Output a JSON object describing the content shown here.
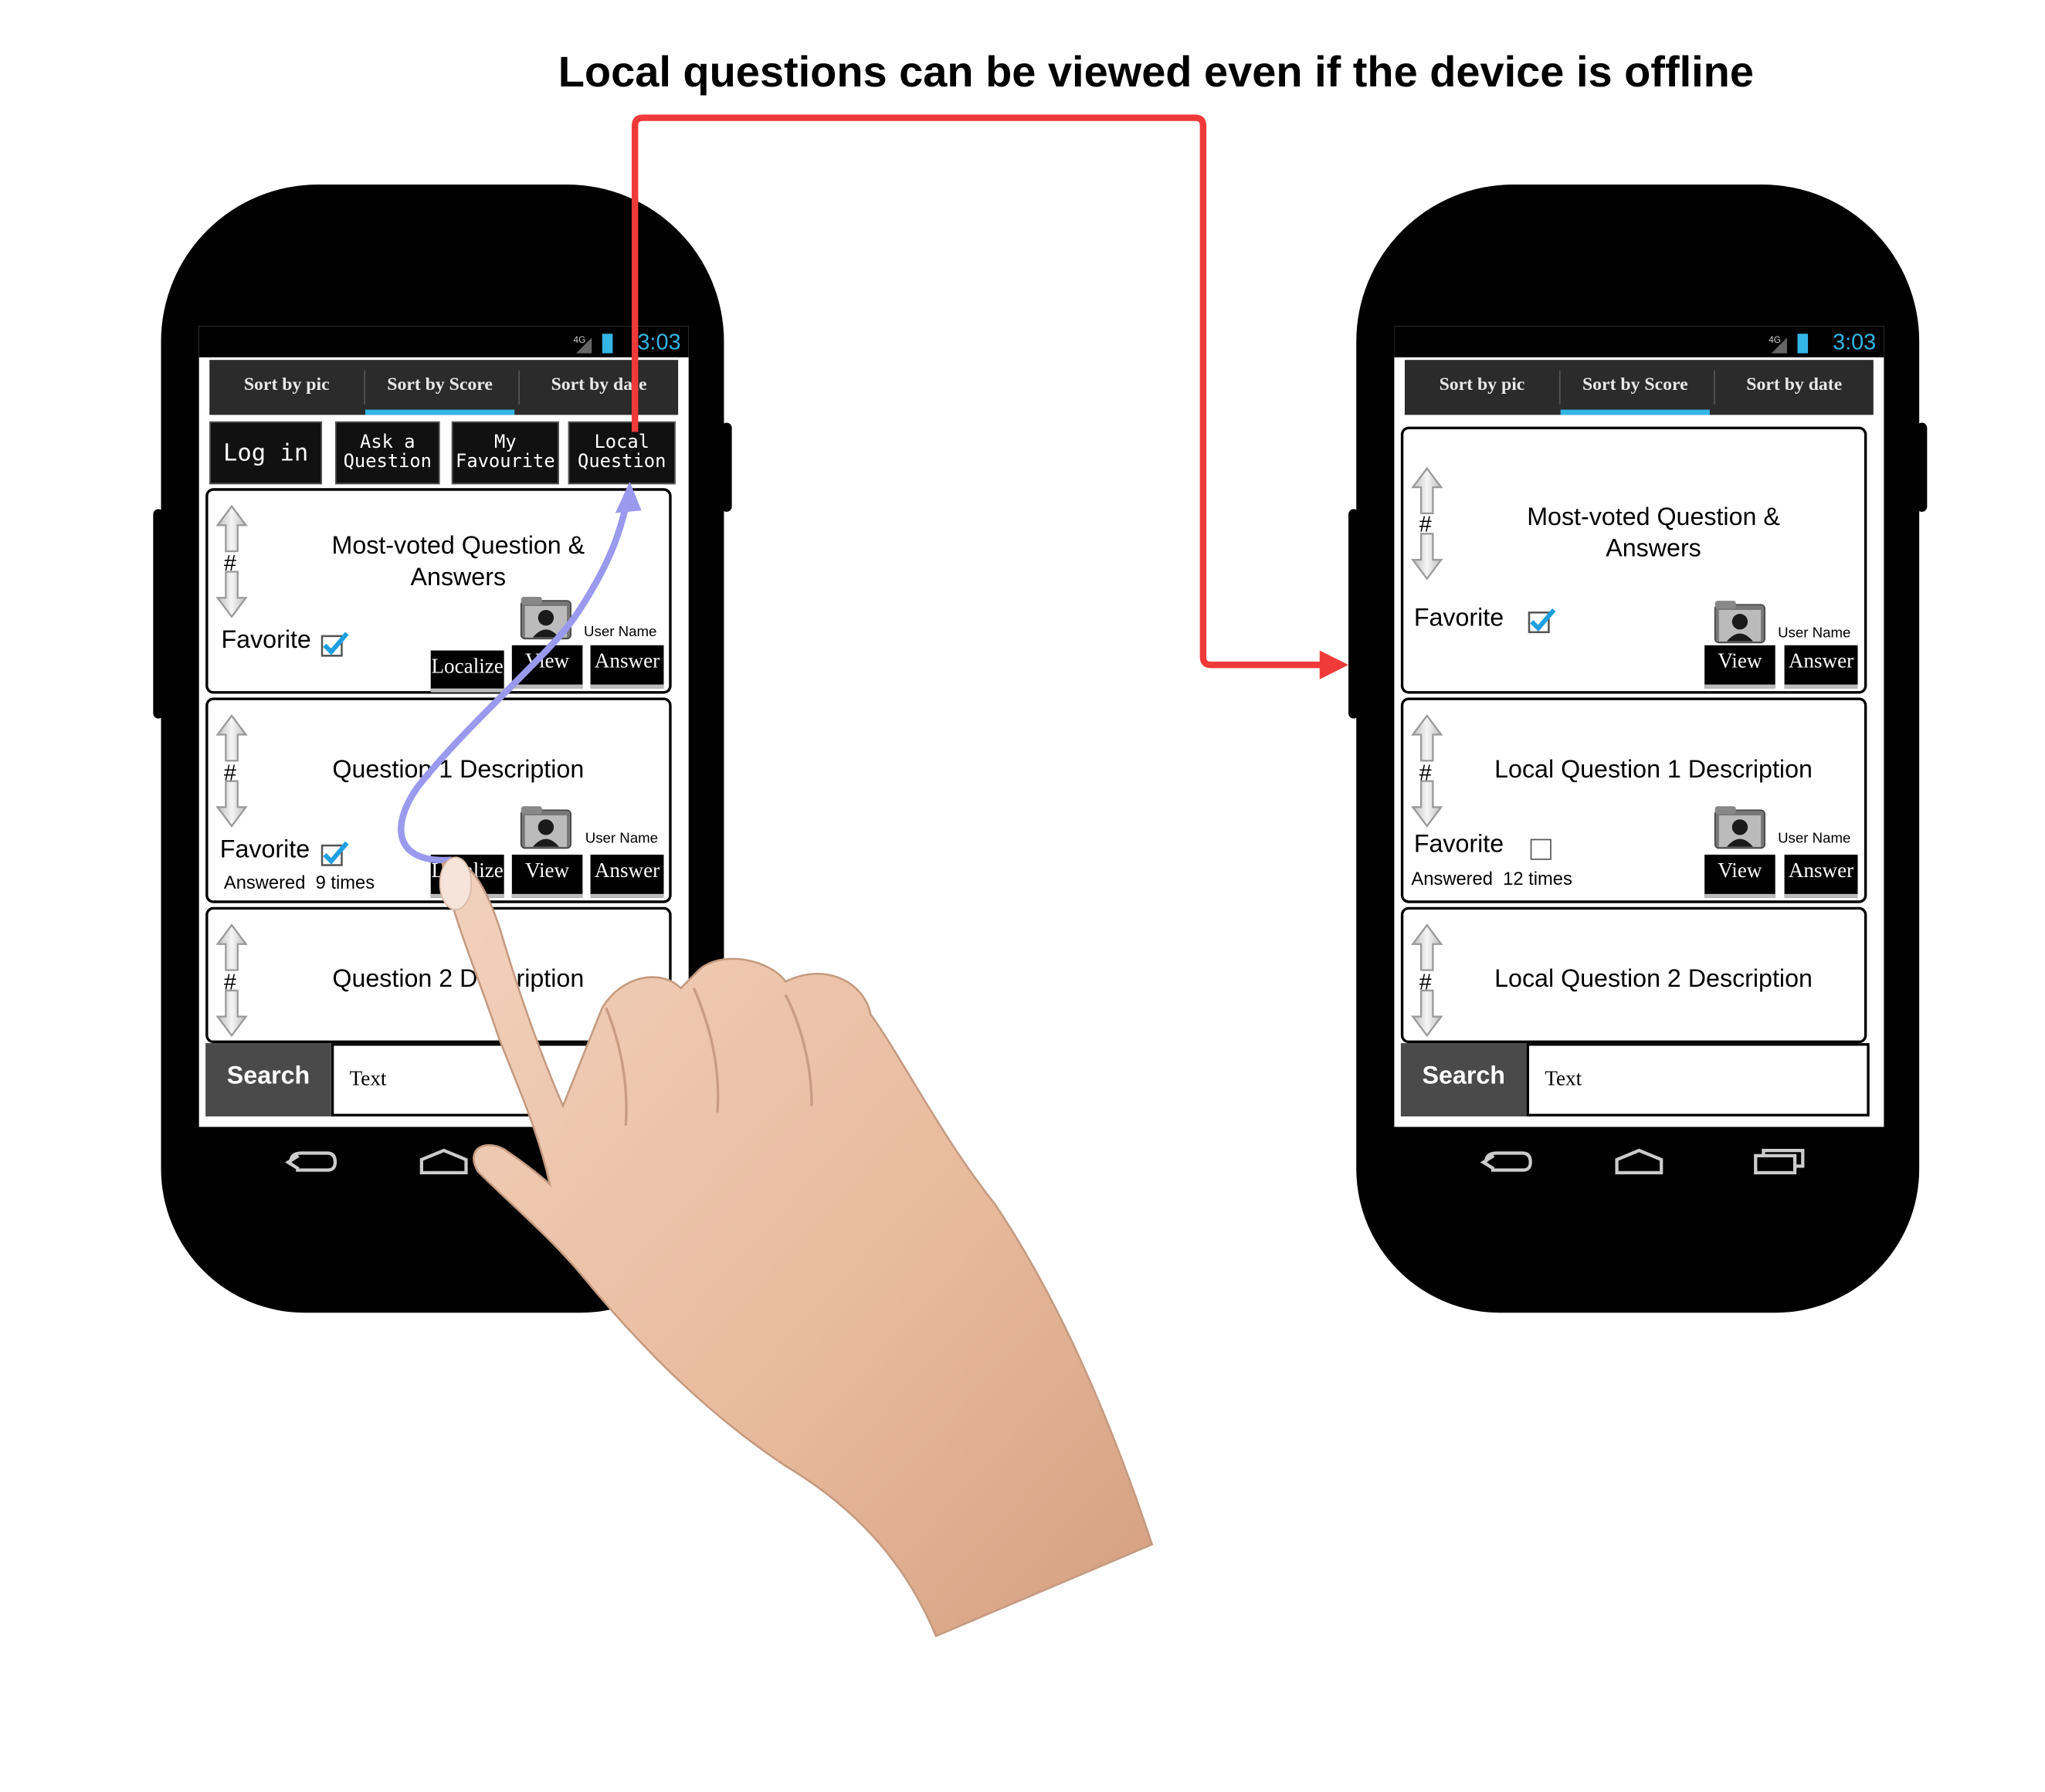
{
  "headline": "Local questions can be viewed even if the device is offline",
  "colors": {
    "accent": "#33b5e5",
    "arrow_red": "#f03a3a",
    "gesture_path": "#9999ee",
    "tab_bar": "#2b2b2b"
  },
  "left_phone": {
    "status": {
      "time": "3:03",
      "network": "4G"
    },
    "tabs": [
      "Sort by pic",
      "Sort by Score",
      "Sort by date"
    ],
    "selected_tab": "Sort by Score",
    "action_buttons": {
      "login": "Log in",
      "ask": [
        "Ask a",
        "Question"
      ],
      "favourite": [
        "My",
        "Favourite"
      ],
      "local": [
        "Local",
        "Question"
      ]
    },
    "cards": [
      {
        "vote": "#",
        "title": "Most-voted Question & Answers",
        "favorite": "Favorite",
        "favorite_checked": true,
        "user": "User Name",
        "buttons": [
          "Localize",
          "View",
          "Answer"
        ]
      },
      {
        "vote": "#",
        "title": "Question 1 Description",
        "favorite": "Favorite",
        "favorite_checked": true,
        "answered": "Answered  9 times",
        "user": "User Name",
        "buttons": [
          "Localize",
          "View",
          "Answer"
        ]
      },
      {
        "vote": "#",
        "title": "Question 2 Description"
      }
    ],
    "search": {
      "label": "Search",
      "value": "Text"
    },
    "nav_icons": [
      "back-icon",
      "home-icon"
    ]
  },
  "right_phone": {
    "status": {
      "time": "3:03",
      "network": "4G"
    },
    "tabs": [
      "Sort by pic",
      "Sort by Score",
      "Sort by date"
    ],
    "selected_tab": "Sort by Score",
    "cards": [
      {
        "vote": "#",
        "title": "Most-voted Question & Answers",
        "favorite": "Favorite",
        "favorite_checked": true,
        "user": "User Name",
        "buttons": [
          "View",
          "Answer"
        ]
      },
      {
        "vote": "#",
        "title": "Local Question 1 Description",
        "favorite": "Favorite",
        "favorite_checked": false,
        "answered": "Answered  12 times",
        "user": "User Name",
        "buttons": [
          "View",
          "Answer"
        ]
      },
      {
        "vote": "#",
        "title": "Local Question 2 Description"
      }
    ],
    "search": {
      "label": "Search",
      "value": "Text"
    },
    "nav_icons": [
      "back-icon",
      "home-icon",
      "recent-apps-icon"
    ]
  }
}
